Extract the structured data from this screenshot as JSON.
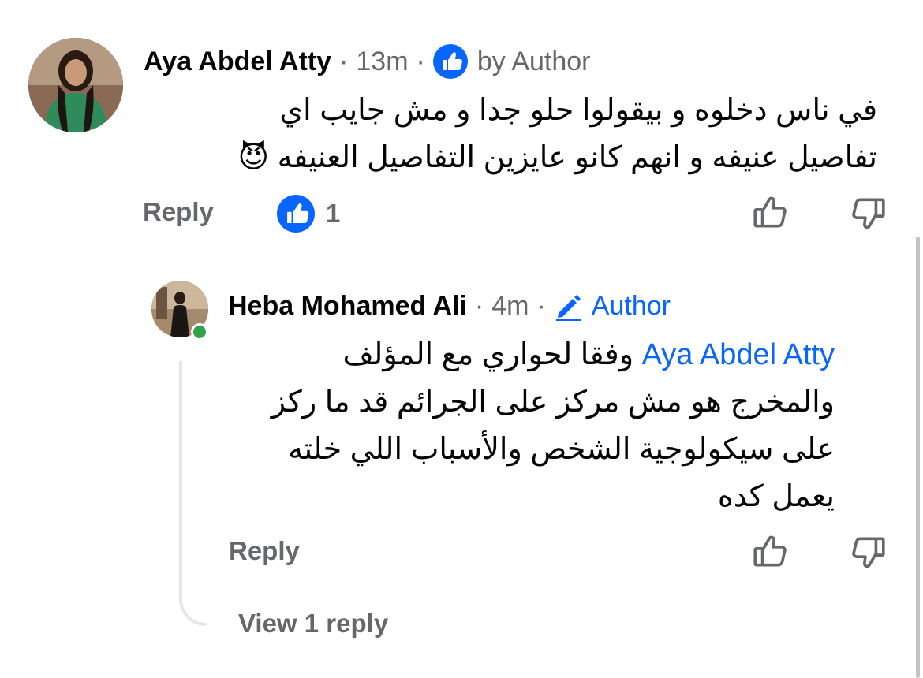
{
  "comment": {
    "author": "Aya Abdel Atty",
    "time": "13m",
    "badge_label": "by Author",
    "lines": [
      "في ناس دخلوه و بيقولوا حلو جدا و مش جايب اي",
      "تفاصيل عنيفه و انهم كانو عايزين التفاصيل العنيفه 😈"
    ],
    "reply_label": "Reply",
    "like_count": "1"
  },
  "reply": {
    "author": "Heba Mohamed Ali",
    "time": "4m",
    "badge_label": "Author",
    "mention": "Aya Abdel Atty",
    "line1_text": "وفقا لحواري مع المؤلف",
    "lines": [
      "والمخرج هو مش مركز على الجرائم قد ما ركز",
      "على سيكولوجية الشخص والأسباب اللي خلته",
      "يعمل كده"
    ],
    "reply_label": "Reply",
    "view_replies": "View 1 reply"
  },
  "colors": {
    "accent": "#0866ff",
    "muted": "#65676b",
    "online": "#31a24c"
  }
}
